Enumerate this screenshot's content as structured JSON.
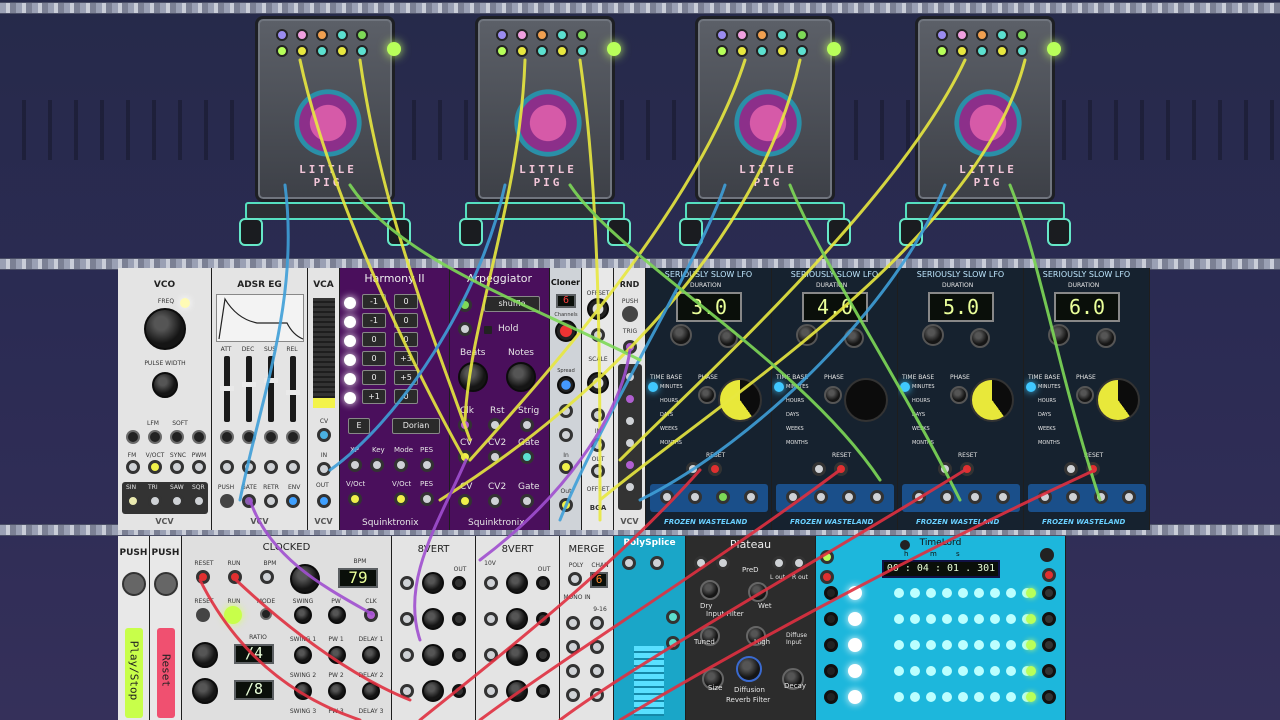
{
  "pigs": [
    {
      "title_line1": "LITTLE",
      "title_line2": "PIG"
    },
    {
      "title_line1": "LITTLE",
      "title_line2": "PIG"
    },
    {
      "title_line1": "LITTLE",
      "title_line2": "PIG"
    },
    {
      "title_line1": "LITTLE",
      "title_line2": "PIG"
    }
  ],
  "vco": {
    "title": "VCO",
    "freq": "FREQ",
    "pulse_width": "PULSE WIDTH",
    "lfm": "LFM",
    "soft": "SOFT",
    "fm": "FM",
    "voct": "V/OCT",
    "sync": "SYNC",
    "pwm": "PWM",
    "sin": "SIN",
    "tri": "TRI",
    "saw": "SAW",
    "sqr": "SQR",
    "brand": "VCV"
  },
  "adsr": {
    "title": "ADSR EG",
    "att": "ATT",
    "dec": "DEC",
    "sus": "SUS",
    "rel": "REL",
    "push": "PUSH",
    "gate": "GATE",
    "retr": "RETR",
    "env": "ENV",
    "brand": "VCV"
  },
  "vca": {
    "title": "VCA",
    "cv": "CV",
    "in": "IN",
    "out": "OUT",
    "brand": "VCV"
  },
  "harmony": {
    "title": "Harmony II",
    "rows": [
      [
        "-1",
        "0"
      ],
      [
        "-1",
        "0"
      ],
      [
        "0",
        "0"
      ],
      [
        "0",
        "+3"
      ],
      [
        "0",
        "+5"
      ],
      [
        "+1",
        "0"
      ]
    ],
    "key": "E",
    "mode": "Dorian",
    "xp": "XP",
    "key_label": "Key",
    "mode_label": "Mode",
    "pes": "PES",
    "voct": "V/Oct",
    "voct2": "V/Oct",
    "pes2": "PES",
    "brand": "Squinktronix"
  },
  "arp": {
    "title": "Arpeggiator",
    "mode": "shuffle",
    "hold": "Hold",
    "beats": "Beats",
    "notes": "Notes",
    "clk": "Clk",
    "rst": "Rst",
    "strig": "Strig",
    "cv": "CV",
    "cv2": "CV2",
    "gate": "Gate",
    "cv_out": "CV",
    "cv2_out": "CV2",
    "gate_out": "Gate",
    "brand": "Squinktronix"
  },
  "cloner": {
    "title": "Cloner",
    "channels_value": "6",
    "channels": "Channels",
    "spread": "Spread",
    "in": "In",
    "out": "Out"
  },
  "offset": {
    "title": "OFFSET",
    "scale": "SCALE",
    "in": "IN",
    "out": "OUT",
    "label": "OFFSET",
    "brand": "BGA"
  },
  "rnd": {
    "title": "RND",
    "push": "PUSH",
    "trig": "TRIG",
    "brand": "VCV"
  },
  "lfos": [
    {
      "title": "SERIOUSLY SLOW LFO",
      "duration_label": "DURATION",
      "duration": "3.0",
      "time_base": "TIME BASE",
      "phase": "PHASE",
      "units": [
        "MINUTES",
        "HOURS",
        "DAYS",
        "WEEKS",
        "MONTHS"
      ],
      "reset": "RESET",
      "brand": "FROZEN WASTELAND"
    },
    {
      "title": "SERIOUSLY SLOW LFO",
      "duration_label": "DURATION",
      "duration": "4.0",
      "time_base": "TIME BASE",
      "phase": "PHASE",
      "units": [
        "MINUTES",
        "HOURS",
        "DAYS",
        "WEEKS",
        "MONTHS"
      ],
      "reset": "RESET",
      "brand": "FROZEN WASTELAND"
    },
    {
      "title": "SERIOUSLY SLOW LFO",
      "duration_label": "DURATION",
      "duration": "5.0",
      "time_base": "TIME BASE",
      "phase": "PHASE",
      "units": [
        "MINUTES",
        "HOURS",
        "DAYS",
        "WEEKS",
        "MONTHS"
      ],
      "reset": "RESET",
      "brand": "FROZEN WASTELAND"
    },
    {
      "title": "SERIOUSLY SLOW LFO",
      "duration_label": "DURATION",
      "duration": "6.0",
      "time_base": "TIME BASE",
      "phase": "PHASE",
      "units": [
        "MINUTES",
        "HOURS",
        "DAYS",
        "WEEKS",
        "MONTHS"
      ],
      "reset": "RESET",
      "brand": "FROZEN WASTELAND"
    }
  ],
  "push1": {
    "title": "PUSH",
    "button": "Play/Stop"
  },
  "push2": {
    "title": "PUSH",
    "button": "Reset"
  },
  "clocked": {
    "title": "CLOCKED",
    "reset": "RESET",
    "run": "RUN",
    "bpm": "BPM",
    "bpm_value": "79",
    "reset2": "RESET",
    "run2": "RUN",
    "mode": "MODE",
    "swing": "SWING",
    "pw": "PW",
    "clk": "CLK",
    "ratio": "RATIO",
    "ratio1": "/4",
    "ratio2": "/8",
    "swing1": "SWING 1",
    "pw1": "PW 1",
    "delay1": "DELAY 1",
    "swing2": "SWING 2",
    "pw2": "PW 2",
    "delay2": "DELAY 2",
    "swing3": "SWING 3",
    "pw3": "PW 3",
    "delay3": "DELAY 3"
  },
  "bvert1": {
    "title": "8VERT",
    "out": "OUT"
  },
  "bvert2": {
    "title": "8VERT",
    "label_10v": "10V",
    "out": "OUT"
  },
  "merge": {
    "title": "MERGE",
    "poly": "POLY",
    "chan": "CHAN",
    "chan_value": "6",
    "mono_in": "MONO IN",
    "range": "9-16"
  },
  "polysplice": {
    "title": "PolySplice"
  },
  "plateau": {
    "title": "Plateau",
    "pre": "PreD",
    "l_out": "L out",
    "r_out": "R out",
    "dry": "Dry",
    "wet": "Wet",
    "input_filter": "Input Filter",
    "tuned": "Tuned",
    "high": "High",
    "diffuse": "Diffuse Input",
    "size": "Size",
    "diffusion": "Diffusion",
    "reverb_filter": "Reverb Filter",
    "decay": "Decay"
  },
  "timelord": {
    "title": "TimeLord",
    "h": "h",
    "m": "m",
    "s": "s",
    "time": "00 : 04 : 01 . 301"
  }
}
